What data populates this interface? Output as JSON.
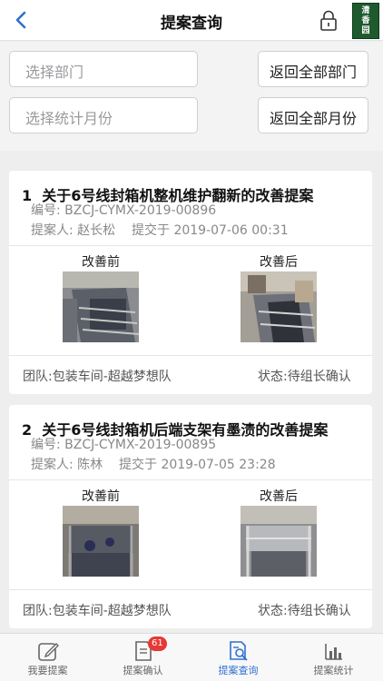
{
  "header": {
    "title": "提案查询",
    "logo_text": "清香园"
  },
  "filters": {
    "department_placeholder": "选择部门",
    "department_reset": "返回全部部门",
    "month_placeholder": "选择统计月份",
    "month_reset": "返回全部月份"
  },
  "cards": [
    {
      "index": "1",
      "title": "关于6号线封箱机整机维护翻新的改善提案",
      "code_label": "编号:",
      "code": "BZCJ-CYMX-2019-00896",
      "proposer_label": "提案人:",
      "proposer": "赵长松",
      "submitted_label": "提交于",
      "submitted": "2019-07-06 00:31",
      "before_label": "改善前",
      "after_label": "改善后",
      "team": "团队:包装车间-超越梦想队",
      "status": "状态:待组长确认"
    },
    {
      "index": "2",
      "title": "关于6号线封箱机后端支架有墨渍的改善提案",
      "code_label": "编号:",
      "code": "BZCJ-CYMX-2019-00895",
      "proposer_label": "提案人:",
      "proposer": "陈林",
      "submitted_label": "提交于",
      "submitted": "2019-07-05 23:28",
      "before_label": "改善前",
      "after_label": "改善后",
      "team": "团队:包装车间-超越梦想队",
      "status": "状态:待组长确认"
    }
  ],
  "tabbar": {
    "items": [
      {
        "label": "我要提案",
        "icon": "edit-icon"
      },
      {
        "label": "提案确认",
        "icon": "document-icon",
        "badge": "61"
      },
      {
        "label": "提案查询",
        "icon": "search-document-icon",
        "active": true
      },
      {
        "label": "提案统计",
        "icon": "bar-chart-icon"
      }
    ]
  },
  "colors": {
    "accent": "#2f6fd0",
    "badge": "#e53935",
    "logo_bg": "#1f5a2e"
  }
}
